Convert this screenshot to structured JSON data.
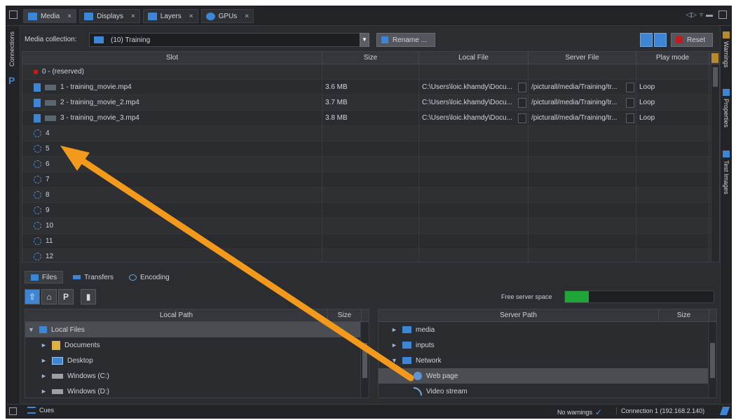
{
  "tabs": [
    {
      "label": "Media",
      "close": "×"
    },
    {
      "label": "Displays",
      "close": "×"
    },
    {
      "label": "Layers",
      "close": "×"
    },
    {
      "label": "GPUs",
      "close": "×"
    }
  ],
  "left_sidebar": {
    "label": "Connections",
    "logo": "P"
  },
  "right_sidebar": {
    "items": [
      "Warnings",
      "Properties",
      "Test Images"
    ]
  },
  "collection": {
    "label": "Media collection:",
    "value": "(10) Training",
    "rename_label": "Rename ...",
    "reset_label": "Reset"
  },
  "media_table": {
    "columns": [
      "Slot",
      "Size",
      "Local File",
      "Server File",
      "Play mode"
    ],
    "rows": [
      {
        "slot": "0 - (reserved)",
        "size": "",
        "local": "",
        "server": "",
        "play": "",
        "kind": "reserved"
      },
      {
        "slot": "1 - training_movie.mp4",
        "size": "3.6 MB",
        "local": "C:\\Users\\loic.khamdy\\Docu...",
        "server": "/picturall/media/Training/tr...",
        "play": "Loop",
        "kind": "video"
      },
      {
        "slot": "2 - training_movie_2.mp4",
        "size": "3.7 MB",
        "local": "C:\\Users\\loic.khamdy\\Docu...",
        "server": "/picturall/media/Training/tr...",
        "play": "Loop",
        "kind": "video"
      },
      {
        "slot": "3 - training_movie_3.mp4",
        "size": "3.8 MB",
        "local": "C:\\Users\\loic.khamdy\\Docu...",
        "server": "/picturall/media/Training/tr...",
        "play": "Loop",
        "kind": "video"
      },
      {
        "slot": "4",
        "kind": "empty"
      },
      {
        "slot": "5",
        "kind": "empty"
      },
      {
        "slot": "6",
        "kind": "empty"
      },
      {
        "slot": "7",
        "kind": "empty"
      },
      {
        "slot": "8",
        "kind": "empty"
      },
      {
        "slot": "9",
        "kind": "empty"
      },
      {
        "slot": "10",
        "kind": "empty"
      },
      {
        "slot": "11",
        "kind": "empty"
      },
      {
        "slot": "12",
        "kind": "empty"
      }
    ]
  },
  "files_tabs": [
    {
      "label": "Files"
    },
    {
      "label": "Transfers"
    },
    {
      "label": "Encoding"
    }
  ],
  "toolbar": {
    "tools": [
      "⇧",
      "⌂",
      "P",
      "▮"
    ],
    "free_space_label": "Free server space"
  },
  "local_pane": {
    "columns": [
      "Local Path",
      "Size"
    ],
    "items": [
      {
        "label": "Local Files",
        "icon": "home-icon"
      },
      {
        "label": "Documents",
        "icon": "documents-folder-icon"
      },
      {
        "label": "Desktop",
        "icon": "desktop-icon"
      },
      {
        "label": "Windows  (C:)",
        "icon": "drive-icon"
      },
      {
        "label": "Windows  (D:)",
        "icon": "drive-icon"
      }
    ]
  },
  "server_pane": {
    "columns": [
      "Server Path",
      "Size"
    ],
    "items": [
      {
        "label": "media",
        "icon": "folder-icon"
      },
      {
        "label": "inputs",
        "icon": "folder-icon"
      },
      {
        "label": "Network",
        "icon": "folder-icon"
      },
      {
        "label": "Web page",
        "icon": "globe-icon"
      },
      {
        "label": "Video stream",
        "icon": "stream-icon"
      }
    ]
  },
  "statusbar": {
    "cues_label": "Cues",
    "warnings": "No warnings",
    "connection": "Connection 1 (192.168.2.140)"
  },
  "colors": {
    "accent": "#3d86d6",
    "annotation": "#f39a1c",
    "free_space": "#20a53a",
    "reset": "#c41a1a"
  }
}
